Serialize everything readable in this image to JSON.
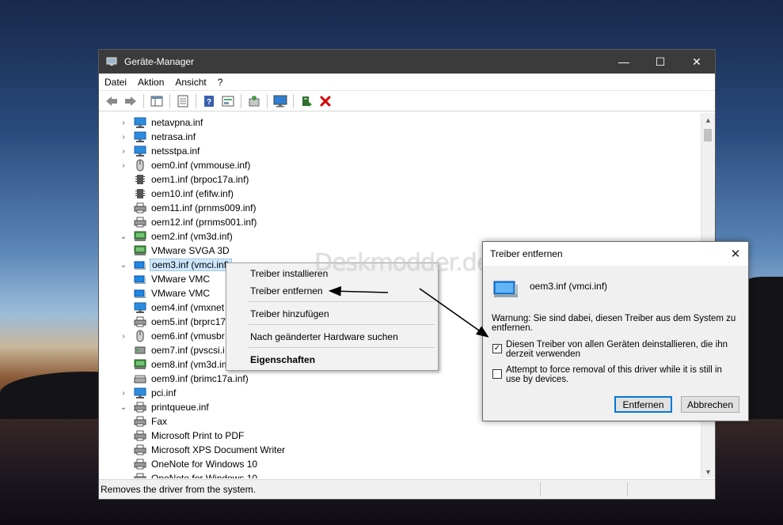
{
  "window": {
    "title": "Geräte-Manager",
    "controls": {
      "minimize": "—",
      "maximize": "☐",
      "close": "✕"
    }
  },
  "menu": [
    "Datei",
    "Aktion",
    "Ansicht",
    "?"
  ],
  "toolbar": {
    "icons": [
      "back-arrow-icon",
      "forward-arrow-icon",
      "console-tree-icon",
      "properties-icon",
      "help-icon",
      "view-icon",
      "scan-hardware-icon",
      "monitor-icon",
      "update-driver-icon",
      "remove-driver-icon"
    ],
    "remove_color": "#d40000"
  },
  "tree": [
    {
      "label": "netavpna.inf",
      "level": 0,
      "expander": "›",
      "icon": "network-icon"
    },
    {
      "label": "netrasa.inf",
      "level": 0,
      "expander": "›",
      "icon": "network-icon"
    },
    {
      "label": "netsstpa.inf",
      "level": 0,
      "expander": "›",
      "icon": "network-icon"
    },
    {
      "label": "oem0.inf (vmmouse.inf)",
      "level": 0,
      "expander": "›",
      "icon": "mouse-icon"
    },
    {
      "label": "oem1.inf (brpoc17a.inf)",
      "level": 0,
      "expander": "",
      "icon": "chip-icon"
    },
    {
      "label": "oem10.inf (efifw.inf)",
      "level": 0,
      "expander": "",
      "icon": "chip-icon"
    },
    {
      "label": "oem11.inf (prnms009.inf)",
      "level": 0,
      "expander": "",
      "icon": "printer-icon"
    },
    {
      "label": "oem12.inf (prnms001.inf)",
      "level": 0,
      "expander": "",
      "icon": "printer-icon"
    },
    {
      "label": "oem2.inf (vm3d.inf)",
      "level": 0,
      "expander": "⌄",
      "icon": "display-adapter-icon"
    },
    {
      "label": "VMware SVGA 3D",
      "level": 1,
      "expander": "",
      "icon": "display-adapter-icon"
    },
    {
      "label": "oem3.inf (vmci.inf)",
      "level": 0,
      "expander": "⌄",
      "icon": "network-card-icon",
      "selected": true
    },
    {
      "label": "VMware VMC",
      "level": 1,
      "expander": "",
      "icon": "network-card-icon"
    },
    {
      "label": "VMware VMC",
      "level": 1,
      "expander": "",
      "icon": "network-card-icon"
    },
    {
      "label": "oem4.inf (vmxnet",
      "level": 0,
      "expander": "",
      "icon": "network-icon"
    },
    {
      "label": "oem5.inf (brprc17",
      "level": 0,
      "expander": "",
      "icon": "printer-icon"
    },
    {
      "label": "oem6.inf (vmusbr",
      "level": 0,
      "expander": "›",
      "icon": "mouse-icon"
    },
    {
      "label": "oem7.inf (pvscsi.i",
      "level": 0,
      "expander": "",
      "icon": "storage-icon"
    },
    {
      "label": "oem8.inf (vm3d.in",
      "level": 0,
      "expander": "",
      "icon": "display-adapter-icon"
    },
    {
      "label": "oem9.inf (brimc17a.inf)",
      "level": 0,
      "expander": "",
      "icon": "scanner-icon"
    },
    {
      "label": "pci.inf",
      "level": 0,
      "expander": "›",
      "icon": "network-icon"
    },
    {
      "label": "printqueue.inf",
      "level": 0,
      "expander": "⌄",
      "icon": "printer-icon"
    },
    {
      "label": "Fax",
      "level": 1,
      "expander": "",
      "icon": "printer-icon"
    },
    {
      "label": "Microsoft Print to PDF",
      "level": 1,
      "expander": "",
      "icon": "printer-icon"
    },
    {
      "label": "Microsoft XPS Document Writer",
      "level": 1,
      "expander": "",
      "icon": "printer-icon"
    },
    {
      "label": "OneNote for Windows 10",
      "level": 1,
      "expander": "",
      "icon": "printer-icon"
    },
    {
      "label": "OneNote for Windows 10",
      "level": 1,
      "expander": "",
      "icon": "printer-icon"
    }
  ],
  "scrollbar": {
    "up": "▲",
    "down": "▼"
  },
  "status": "Removes the driver from the system.",
  "context_menu": {
    "items": [
      "Treiber installieren",
      "Treiber entfernen",
      "Treiber hinzufügen",
      "Nach geänderter Hardware suchen",
      "Eigenschaften"
    ]
  },
  "watermark": "Deskmodder.de",
  "dialog": {
    "title": "Treiber entfernen",
    "close": "✕",
    "driver_name": "oem3.inf (vmci.inf)",
    "warning": "Warnung: Sie sind dabei, diesen Treiber aus dem System zu entfernen.",
    "checkbox1": {
      "label": "Diesen Treiber von allen Geräten deinstallieren, die ihn derzeit verwenden",
      "checked": true,
      "mark": "✓"
    },
    "checkbox2": {
      "label": "Attempt to force removal of this driver while it is still in use by devices.",
      "checked": false
    },
    "buttons": {
      "primary": "Entfernen",
      "cancel": "Abbrechen"
    }
  }
}
